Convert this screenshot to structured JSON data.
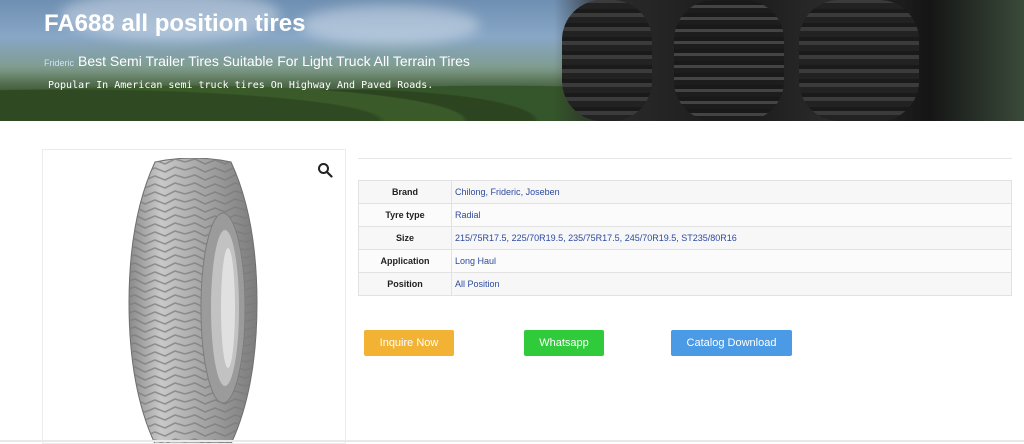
{
  "hero": {
    "title": "FA688 all position tires",
    "brand_tag": "Frideric",
    "subtitle": "Best Semi Trailer Tires Suitable For Light Truck All Terrain Tires",
    "description": "Popular In American semi truck tires On Highway And Paved Roads."
  },
  "gallery": {
    "zoom_icon": "search-icon"
  },
  "specs": {
    "brand": {
      "label": "Brand",
      "values": [
        "Chilong",
        "Frideric",
        "Joseben"
      ]
    },
    "tyre_type": {
      "label": "Tyre type",
      "values": [
        "Radial"
      ]
    },
    "size": {
      "label": "Size",
      "values": [
        "215/75R17.5",
        "225/70R19.5",
        "235/75R17.5",
        "245/70R19.5",
        "ST235/80R16"
      ]
    },
    "application": {
      "label": "Application",
      "values": [
        "Long Haul"
      ]
    },
    "position": {
      "label": "Position",
      "values": [
        "All Position"
      ]
    }
  },
  "buttons": {
    "inquire": "Inquire Now",
    "whatsapp": "Whatsapp",
    "catalog": "Catalog Download"
  },
  "colors": {
    "inquire": "#f2b233",
    "whatsapp": "#2fcb3a",
    "catalog": "#4a9ae6",
    "link": "#2d4aa0"
  }
}
